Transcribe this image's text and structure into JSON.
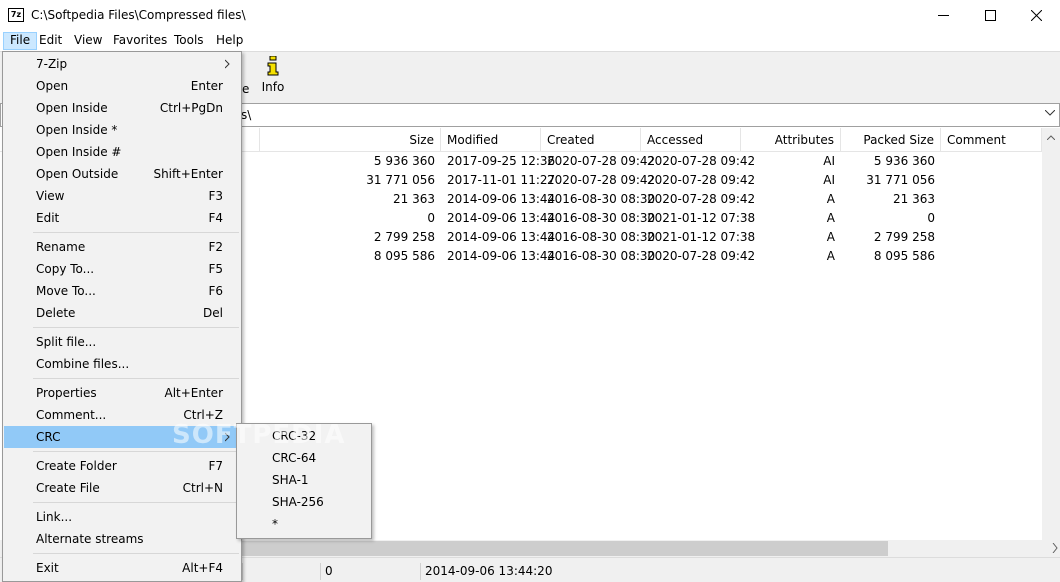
{
  "window": {
    "title": "C:\\Softpedia Files\\Compressed files\\",
    "app_icon_text": "7z"
  },
  "menubar": [
    "File",
    "Edit",
    "View",
    "Favorites",
    "Tools",
    "Help"
  ],
  "toolbar": {
    "partial_label": "e",
    "info_label": "Info"
  },
  "address": {
    "visible_text": "s\\"
  },
  "columns": [
    "Size",
    "Modified",
    "Created",
    "Accessed",
    "Attributes",
    "Packed Size",
    "Comment"
  ],
  "rows": [
    [
      "5 936 360",
      "2017-09-25 12:36",
      "2020-07-28 09:42",
      "2020-07-28 09:42",
      "AI",
      "5 936 360",
      ""
    ],
    [
      "31 771 056",
      "2017-11-01 11:27",
      "2020-07-28 09:42",
      "2020-07-28 09:42",
      "AI",
      "31 771 056",
      ""
    ],
    [
      "21 363",
      "2014-09-06 13:44",
      "2016-08-30 08:30",
      "2020-07-28 09:42",
      "A",
      "21 363",
      ""
    ],
    [
      "0",
      "2014-09-06 13:44",
      "2016-08-30 08:30",
      "2021-01-12 07:38",
      "A",
      "0",
      ""
    ],
    [
      "2 799 258",
      "2014-09-06 13:44",
      "2016-08-30 08:30",
      "2021-01-12 07:38",
      "A",
      "2 799 258",
      ""
    ],
    [
      "8 095 586",
      "2014-09-06 13:44",
      "2016-08-30 08:30",
      "2020-07-28 09:42",
      "A",
      "8 095 586",
      ""
    ]
  ],
  "file_menu": [
    {
      "label": "7-Zip",
      "shortcut": "",
      "submenu": true
    },
    {
      "label": "Open",
      "shortcut": "Enter"
    },
    {
      "label": "Open Inside",
      "shortcut": "Ctrl+PgDn"
    },
    {
      "label": "Open Inside *",
      "shortcut": ""
    },
    {
      "label": "Open Inside #",
      "shortcut": ""
    },
    {
      "label": "Open Outside",
      "shortcut": "Shift+Enter"
    },
    {
      "label": "View",
      "shortcut": "F3"
    },
    {
      "label": "Edit",
      "shortcut": "F4"
    },
    {
      "separator": true
    },
    {
      "label": "Rename",
      "shortcut": "F2"
    },
    {
      "label": "Copy To...",
      "shortcut": "F5"
    },
    {
      "label": "Move To...",
      "shortcut": "F6"
    },
    {
      "label": "Delete",
      "shortcut": "Del"
    },
    {
      "separator": true
    },
    {
      "label": "Split file...",
      "shortcut": ""
    },
    {
      "label": "Combine files...",
      "shortcut": ""
    },
    {
      "separator": true
    },
    {
      "label": "Properties",
      "shortcut": "Alt+Enter"
    },
    {
      "label": "Comment...",
      "shortcut": "Ctrl+Z"
    },
    {
      "label": "CRC",
      "shortcut": "",
      "submenu": true,
      "highlighted": true
    },
    {
      "separator": true
    },
    {
      "label": "Create Folder",
      "shortcut": "F7"
    },
    {
      "label": "Create File",
      "shortcut": "Ctrl+N"
    },
    {
      "separator": true
    },
    {
      "label": "Link...",
      "shortcut": ""
    },
    {
      "label": "Alternate streams",
      "shortcut": ""
    },
    {
      "separator": true
    },
    {
      "label": "Exit",
      "shortcut": "Alt+F4"
    }
  ],
  "crc_submenu": [
    "CRC-32",
    "CRC-64",
    "SHA-1",
    "SHA-256",
    "*"
  ],
  "statusbar": {
    "count": "0",
    "modified": "2014-09-06 13:44:20"
  },
  "watermark": "SOFTPEDIA",
  "colors": {
    "menu_highlight": "#91c9f7",
    "menubar_active": "#cce8ff",
    "info_icon": "#f5e000"
  }
}
